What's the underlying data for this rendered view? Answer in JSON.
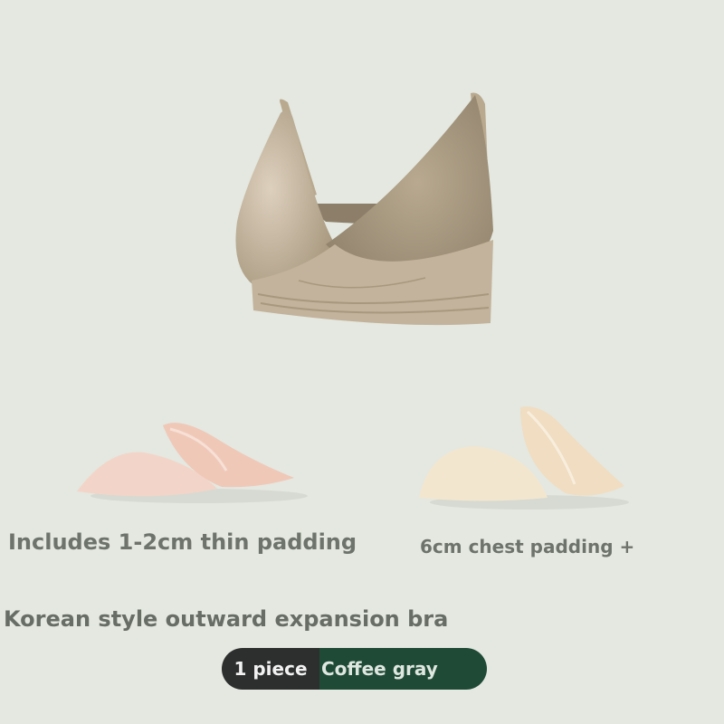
{
  "captions": {
    "left": "Includes 1-2cm thin padding",
    "right": "6cm chest padding +"
  },
  "headline": "Korean style outward expansion bra",
  "option": {
    "quantity": "1 piece",
    "color": "Coffee gray"
  },
  "colors": {
    "background": "#e4e8e0",
    "bra": "#c9bba8",
    "pad_left": "#f2d5c8",
    "pad_right": "#f3e6cf",
    "pill_dark": "#2d2f2e",
    "pill_green": "#1f4a36"
  }
}
